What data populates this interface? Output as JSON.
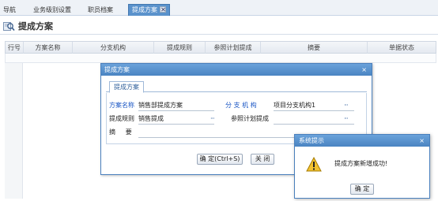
{
  "tabs": [
    {
      "label": "导航"
    },
    {
      "label": "业务级别设置"
    },
    {
      "label": "职员档案"
    },
    {
      "label": "提成方案"
    }
  ],
  "page": {
    "title": "提成方案"
  },
  "grid": {
    "columns": [
      "行号",
      "方案名称",
      "分支机构",
      "提成规则",
      "参照计划提成",
      "摘要",
      "单据状态"
    ]
  },
  "dialog": {
    "title": "提成方案",
    "close_glyph": "×",
    "tab": "提成方案",
    "fields": {
      "scheme_name": {
        "label": "方案名称",
        "value": "销售部提成方案"
      },
      "branch": {
        "label": "分 支 机 构",
        "value": "项目分支机构1"
      },
      "rule": {
        "label": "提成规则",
        "value": "销售提成"
      },
      "ref_plan": {
        "label": "参照计划提成",
        "value": ""
      },
      "summary": {
        "label": "摘     要",
        "value": ""
      }
    },
    "ellipsis": "···",
    "buttons": {
      "ok": "确 定(Ctrl+S)",
      "close": "关 闭"
    }
  },
  "alert": {
    "title": "系统提示",
    "close_glyph": "×",
    "message": "提成方案新增成功!",
    "ok": "确 定"
  },
  "icons": {
    "page": "magnifier-icon",
    "alert": "warning-icon"
  },
  "colors": {
    "accent": "#4a84c2",
    "required_label": "#1a56c4",
    "warning": "#f2c230"
  }
}
